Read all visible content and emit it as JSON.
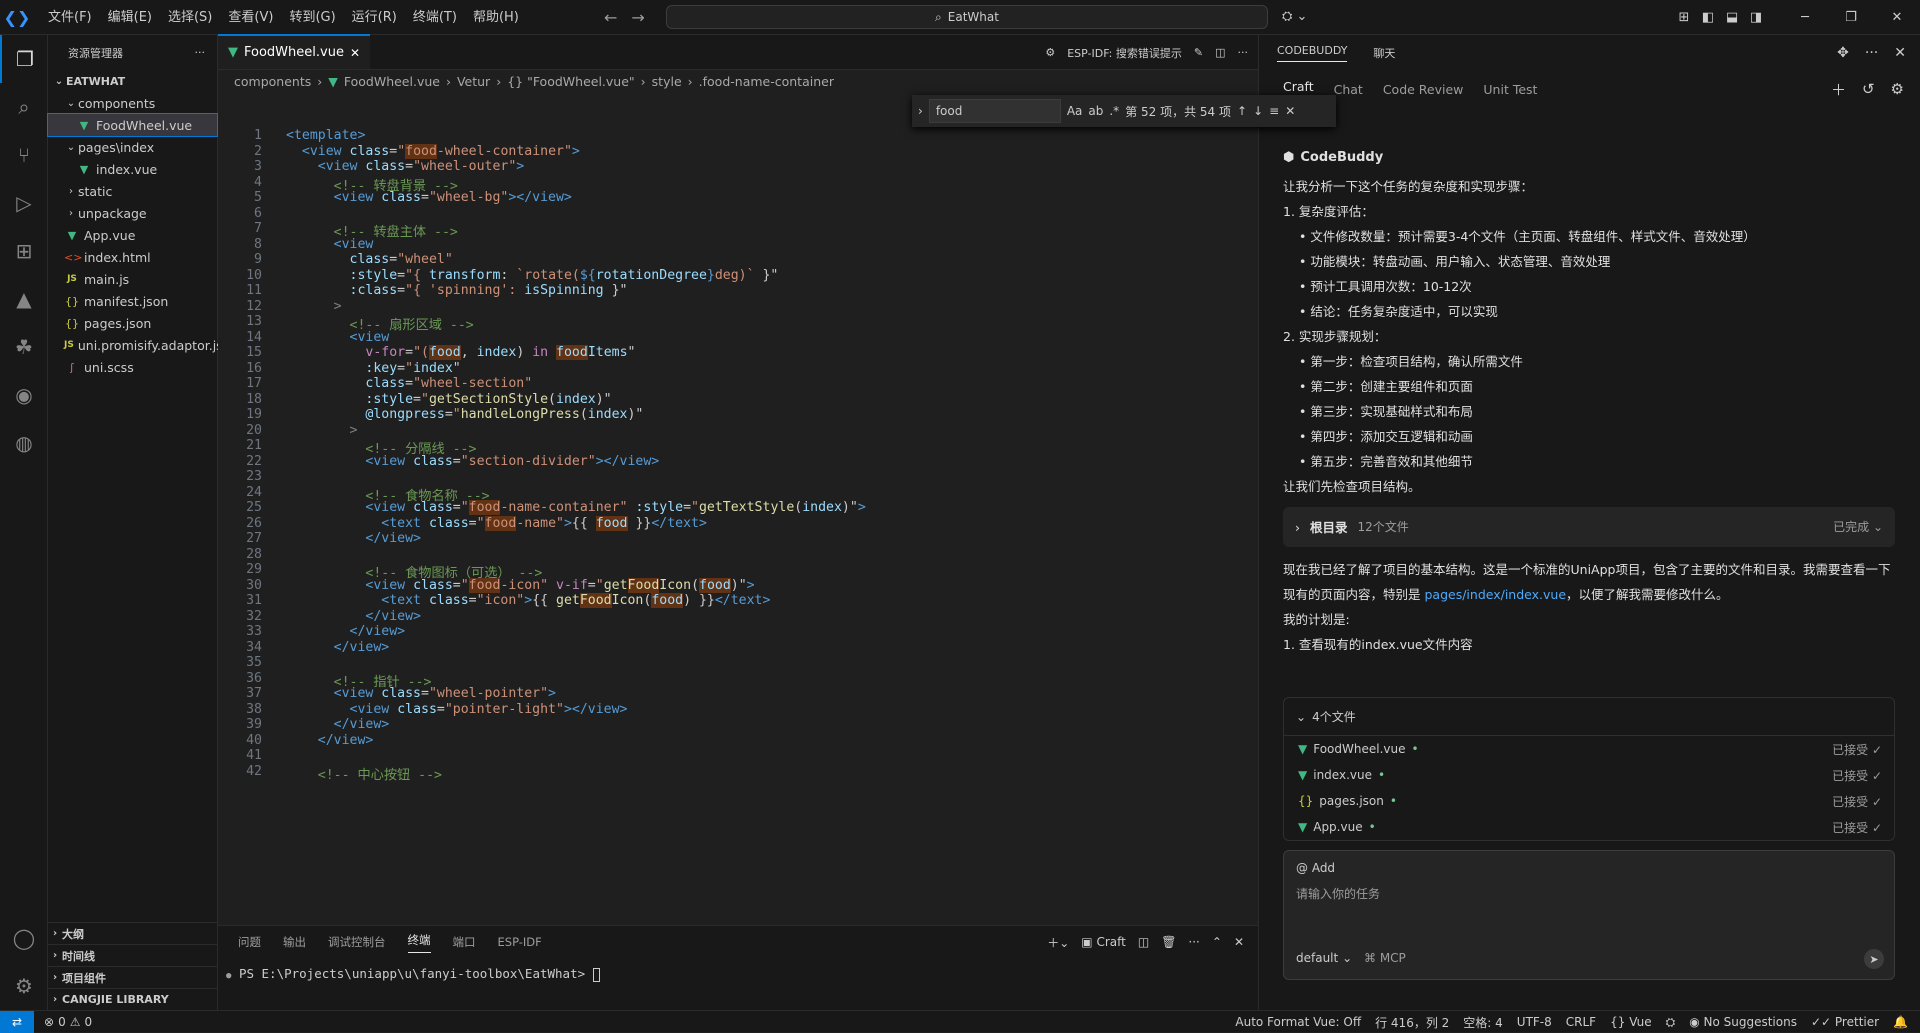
{
  "titlebar": {
    "menu": [
      "文件(F)",
      "编辑(E)",
      "选择(S)",
      "查看(V)",
      "转到(G)",
      "运行(R)",
      "终端(T)",
      "帮助(H)"
    ],
    "search": "EatWhat"
  },
  "sidebar": {
    "title": "资源管理器",
    "root": "EATWHAT",
    "items": [
      {
        "label": "components",
        "type": "folder-open",
        "indent": 1
      },
      {
        "label": "FoodWheel.vue",
        "type": "vue",
        "indent": 2,
        "selected": true
      },
      {
        "label": "pages\\index",
        "type": "folder-open",
        "indent": 1
      },
      {
        "label": "index.vue",
        "type": "vue",
        "indent": 2
      },
      {
        "label": "static",
        "type": "folder",
        "indent": 1
      },
      {
        "label": "unpackage",
        "type": "folder",
        "indent": 1
      },
      {
        "label": "App.vue",
        "type": "vue",
        "indent": 1
      },
      {
        "label": "index.html",
        "type": "html",
        "indent": 1
      },
      {
        "label": "main.js",
        "type": "js",
        "indent": 1
      },
      {
        "label": "manifest.json",
        "type": "json",
        "indent": 1
      },
      {
        "label": "pages.json",
        "type": "json",
        "indent": 1
      },
      {
        "label": "uni.promisify.adaptor.js",
        "type": "js",
        "indent": 1
      },
      {
        "label": "uni.scss",
        "type": "scss",
        "indent": 1
      }
    ],
    "bottom": [
      "大纲",
      "时间线",
      "项目组件",
      "CANGJIE LIBRARY"
    ]
  },
  "editor": {
    "tab": "FoodWheel.vue",
    "espidf": "ESP-IDF: 搜索错误提示",
    "breadcrumb": [
      "components",
      "FoodWheel.vue",
      "Vetur",
      "{} \"FoodWheel.vue\"",
      "style",
      ".food-name-container"
    ],
    "find": {
      "query": "food",
      "result": "第 52 项，共 54 项"
    },
    "line_numbers": [
      1,
      2,
      3,
      4,
      5,
      6,
      7,
      8,
      9,
      10,
      11,
      12,
      13,
      14,
      15,
      16,
      17,
      18,
      19,
      20,
      21,
      22,
      23,
      24,
      25,
      26,
      27,
      28,
      29,
      30,
      31,
      32,
      33,
      34,
      35,
      36,
      37,
      38,
      39,
      40,
      41,
      42
    ]
  },
  "panel": {
    "tabs": [
      "问题",
      "输出",
      "调试控制台",
      "终端",
      "端口",
      "ESP-IDF"
    ],
    "active": "终端",
    "craft": "Craft",
    "prompt": "PS E:\\Projects\\uniapp\\u\\fanyi-toolbox\\EatWhat> "
  },
  "codebuddy": {
    "header_tabs": [
      "CODEBUDDY",
      "聊天"
    ],
    "tabs": [
      "Craft",
      "Chat",
      "Code Review",
      "Unit Test"
    ],
    "brand": "CodeBuddy",
    "intro": "让我分析一下这个任务的复杂度和实现步骤：",
    "sec1": "1. 复杂度评估：",
    "list1": [
      "文件修改数量：预计需要3-4个文件（主页面、转盘组件、样式文件、音效处理）",
      "功能模块：转盘动画、用户输入、状态管理、音效处理",
      "预计工具调用次数：10-12次",
      "结论：任务复杂度适中，可以实现"
    ],
    "sec2": "2. 实现步骤规划：",
    "list2": [
      "第一步：检查项目结构，确认所需文件",
      "第二步：创建主要组件和页面",
      "第三步：实现基础样式和布局",
      "第四步：添加交互逻辑和动画",
      "第五步：完善音效和其他细节"
    ],
    "check": "让我们先检查项目结构。",
    "rootdir": {
      "label": "根目录",
      "count": "12个文件",
      "status": "已完成"
    },
    "para1": "现在我已经了解了项目的基本结构。这是一个标准的UniApp项目，包含了主要的文件和目录。我需要查看一下现有的页面内容，特别是 ",
    "para1_link": "pages/index/index.vue",
    "para1_end": "，以便了解我需要修改什么。",
    "plan": "我的计划是:",
    "plan1": "1. 查看现有的index.vue文件内容",
    "files_header": "4个文件",
    "files": [
      {
        "name": "FoodWheel.vue",
        "type": "vue",
        "status": "已接受"
      },
      {
        "name": "index.vue",
        "type": "vue",
        "status": "已接受"
      },
      {
        "name": "pages.json",
        "type": "json",
        "status": "已接受"
      },
      {
        "name": "App.vue",
        "type": "vue",
        "status": "已接受"
      }
    ],
    "add": "@ Add",
    "placeholder": "请输入你的任务",
    "mode": "default",
    "mcp": "MCP"
  },
  "statusbar": {
    "errors": "0",
    "warnings": "0",
    "autoformat": "Auto Format Vue: Off",
    "position": "行 416，列 2",
    "spaces": "空格: 4",
    "encoding": "UTF-8",
    "eol": "CRLF",
    "lang": "Vue",
    "suggest": "No Suggestions",
    "prettier": "Prettier"
  }
}
